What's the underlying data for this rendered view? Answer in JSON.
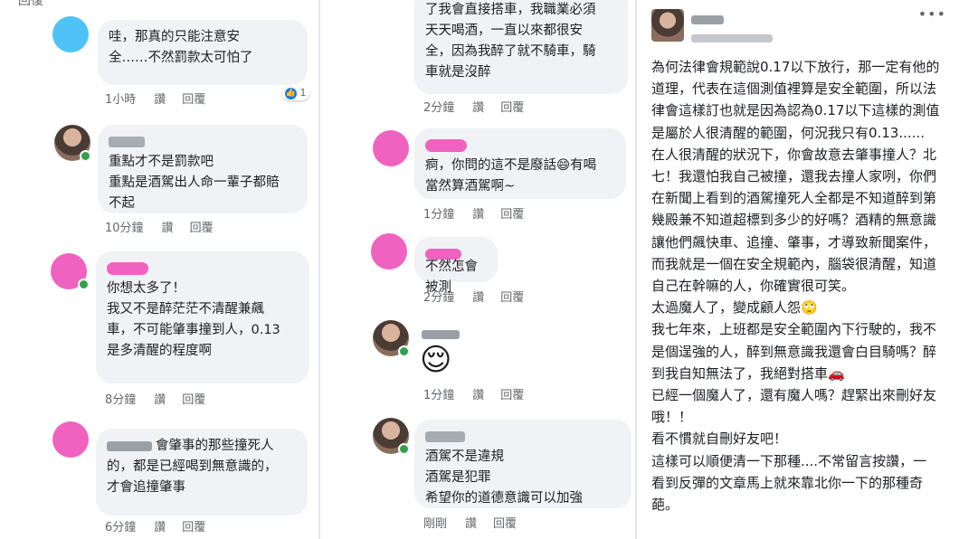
{
  "panel1": {
    "top_fragment": "回復",
    "comments": [
      {
        "text": "哇，那真的只能注意安\n全……不然罰款太可怕了",
        "time": "1小時",
        "like": "讚",
        "reply": "回覆",
        "reaction_count": "1"
      },
      {
        "text": "重點才不是罰款吧\n重點是酒駕出人命一輩子都賠\n不起",
        "time": "10分鐘",
        "like": "讚",
        "reply": "回覆"
      },
      {
        "text": "你想太多了！\n我又不是醉茫茫不清醒兼飆\n車，不可能肇事撞到人，0.13\n是多清醒的程度啊",
        "time": "8分鐘",
        "like": "讚",
        "reply": "回覆"
      },
      {
        "text": "會肇事的那些撞死人\n的，都是已經喝到無意識的，\n才會追撞肇事",
        "time": "6分鐘",
        "like": "讚",
        "reply": "回覆"
      }
    ]
  },
  "panel2": {
    "comments": [
      {
        "text": "了我會直接搭車，我職業必須\n天天喝酒，一直以來都很安\n全，因為我醉了就不騎車，騎\n車就是沒醉",
        "time": "2分鐘",
        "like": "讚",
        "reply": "回覆"
      },
      {
        "text": "痾，你問的這不是廢話😄有喝\n當然算酒駕啊~",
        "time": "1分鐘",
        "like": "讚",
        "reply": "回覆"
      },
      {
        "text": "不然怎會被測",
        "time": "2分鐘",
        "like": "讚",
        "reply": "回覆"
      },
      {
        "emoji": "😌",
        "time": "1分鐘",
        "like": "讚",
        "reply": "回覆"
      },
      {
        "text": "酒駕不是違規\n酒駕是犯罪\n希望你的道德意識可以加強",
        "time": "剛剛",
        "like": "讚",
        "reply": "回覆"
      }
    ]
  },
  "panel3": {
    "more_icon": "•••",
    "post_text": "為何法律會規範說0.17以下放行，那一定有他的\n道理，代表在這個測值裡算是安全範圍，所以法\n律會這樣訂也就是因為認為0.17以下這樣的測值\n是屬於人很清醒的範圍，何況我只有0.13......\n在人很清醒的狀況下，你會故意去肇事撞人？北\n七！我還怕我自己被撞，還我去撞人家咧，你們\n在新聞上看到的酒駕撞死人全都是不知道醉到第\n幾殿兼不知道超標到多少的好嗎？酒精的無意識\n讓他們飆快車、追撞、肇事，才導致新聞案件，\n而我就是一個在安全規範內，腦袋很清醒，知道\n自己在幹嘛的人，你確實很可笑。\n太過魔人了，變成顧人怨🙄\n我七年來，上班都是安全範圍內下行駛的，我不\n是個逞強的人，醉到無意識我還會白目騎嗎？醉\n到我自知無法了，我絕對搭車🚗\n已經一個魔人了，還有魔人嗎？趕緊出來刪好友\n哦！！\n看不慣就自刪好友吧！\n這樣可以順便清一下那種....不常留言按讚，一\n看到反彈的文章馬上就來靠北你一下的那種奇\n葩。"
  },
  "colors": {
    "bubble": "#f0f2f5",
    "meta": "#65676b",
    "accent_pink": "#f062c0",
    "online": "#31a24c"
  }
}
